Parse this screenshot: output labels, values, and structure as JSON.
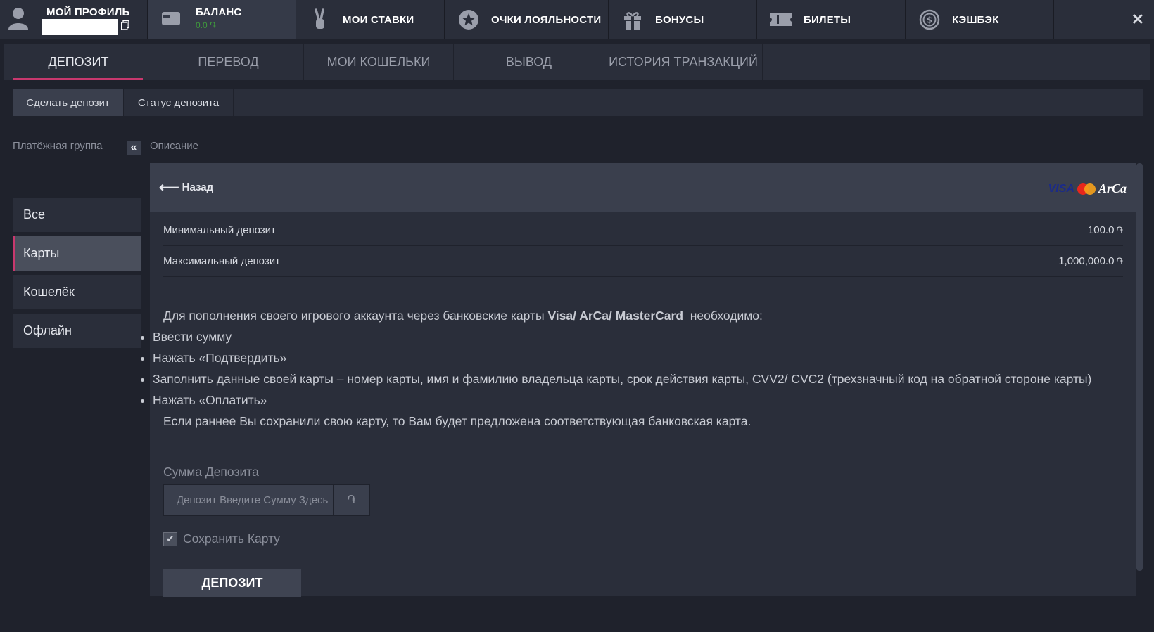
{
  "nav": {
    "profile_label": "МОЙ ПРОФИЛЬ",
    "balance_label": "БАЛАНС",
    "balance_amount": "0.0 ֏",
    "bets_label": "МОИ СТАВКИ",
    "loyalty_label": "ОЧКИ ЛОЯЛЬНОСТИ",
    "bonus_label": "БОНУСЫ",
    "tickets_label": "БИЛЕТЫ",
    "cashback_label": "КЭШБЭК",
    "close_label": "✕"
  },
  "tabs": [
    {
      "label": "ДЕПОЗИТ",
      "active": true
    },
    {
      "label": "ПЕРЕВОД"
    },
    {
      "label": "МОИ КОШЕЛЬКИ"
    },
    {
      "label": "ВЫВОД"
    },
    {
      "label": "ИСТОРИЯ ТРАНЗАКЦИЙ"
    }
  ],
  "subtabs": [
    {
      "label": "Сделать депозит",
      "active": true
    },
    {
      "label": "Статус депозита"
    }
  ],
  "sidebar": {
    "title": "Платёжная группа",
    "collapse_label": "«",
    "items": [
      {
        "label": "Все"
      },
      {
        "label": "Карты",
        "active": true
      },
      {
        "label": "Кошелёк"
      },
      {
        "label": "Офлайн"
      }
    ]
  },
  "main": {
    "section_title": "Описание",
    "back_label": "Назад",
    "logos": {
      "visa": "VISA",
      "arca": "ArCa"
    },
    "limits": [
      {
        "label": "Минимальный депозит",
        "value": "100.0",
        "currency": "֏"
      },
      {
        "label": "Максимальный депозит",
        "value": "1,000,000.0",
        "currency": "֏"
      }
    ],
    "info_intro_before": "Для пополнения своего игрового аккаунта через банковские карты ",
    "info_intro_bold": "Visa/ ArCa/ MasterCard",
    "info_intro_after": "  необходимо:",
    "steps": [
      "Ввести сумму",
      "Нажать «Подтвердить»",
      "Заполнить данные своей карты – номер карты, имя и фамилию владельца карты, срок действия карты, CVV2/ CVC2 (трехзначный код на обратной стороне карты)",
      "Нажать «Оплатить»"
    ],
    "info_footer": "Если раннее Вы сохранили свою карту, то Вам будет предложена соответствующая банковская карта.",
    "amount_label": "Сумма Депозита",
    "amount_placeholder": "Депозит Введите Сумму Здесь",
    "amount_currency": "֏",
    "save_card_label": "Сохранить Карту",
    "save_card_checked": true,
    "deposit_button": "ДЕПОЗИТ"
  },
  "colors": {
    "accent": "#c8386e",
    "balance_green": "#3f9a3c",
    "bg": "#1f222c",
    "panel": "#2a2e3a"
  }
}
